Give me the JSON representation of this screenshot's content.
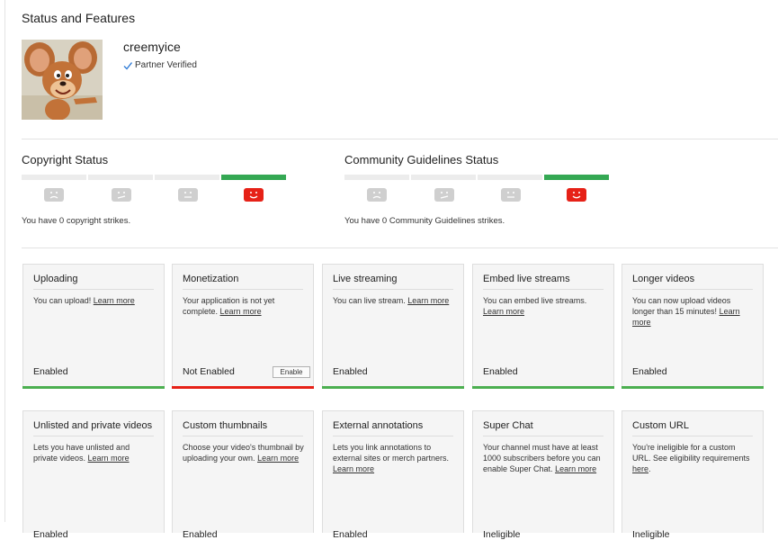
{
  "page": {
    "title": "Status and Features"
  },
  "channel": {
    "name": "creemyice",
    "verified_label": "Partner Verified"
  },
  "copyright": {
    "title": "Copyright Status",
    "strikes_text": "You have 0 copyright strikes."
  },
  "community": {
    "title": "Community Guidelines Status",
    "strikes_text": "You have 0 Community Guidelines strikes."
  },
  "features_row1": [
    {
      "title": "Uploading",
      "desc": "You can upload!",
      "link": "Learn more",
      "status": "Enabled",
      "bar": "green"
    },
    {
      "title": "Monetization",
      "desc": "Your application is not yet complete.",
      "link": "Learn more",
      "status": "Not Enabled",
      "bar": "red",
      "button": "Enable"
    },
    {
      "title": "Live streaming",
      "desc": "You can live stream.",
      "link": "Learn more",
      "status": "Enabled",
      "bar": "green"
    },
    {
      "title": "Embed live streams",
      "desc": "You can embed live streams.",
      "link": "Learn more",
      "status": "Enabled",
      "bar": "green"
    },
    {
      "title": "Longer videos",
      "desc": "You can now upload videos longer than 15 minutes!",
      "link": "Learn more",
      "status": "Enabled",
      "bar": "green"
    }
  ],
  "features_row2": [
    {
      "title": "Unlisted and private videos",
      "desc": "Lets you have unlisted and private videos.",
      "link": "Learn more",
      "status": "Enabled"
    },
    {
      "title": "Custom thumbnails",
      "desc": "Choose your video's thumbnail by uploading your own.",
      "link": "Learn more",
      "status": "Enabled"
    },
    {
      "title": "External annotations",
      "desc": "Lets you link annotations to external sites or merch partners.",
      "link": "Learn more",
      "status": "Enabled"
    },
    {
      "title": "Super Chat",
      "desc": "Your channel must have at least 1000 subscribers before you can enable Super Chat.",
      "link": "Learn more",
      "status": "Ineligible"
    },
    {
      "title": "Custom URL",
      "desc": "You're ineligible for a custom URL. See eligibility requirements",
      "link": "here",
      "status": "Ineligible"
    }
  ],
  "colors": {
    "accent_green": "#4caf50",
    "accent_red": "#e62117",
    "strike_green": "#34a853"
  },
  "icons": {
    "verified": "check-icon",
    "strike_faces": [
      "frown-face-icon",
      "meh-face-icon",
      "neutral-face-icon",
      "smile-face-icon"
    ]
  }
}
